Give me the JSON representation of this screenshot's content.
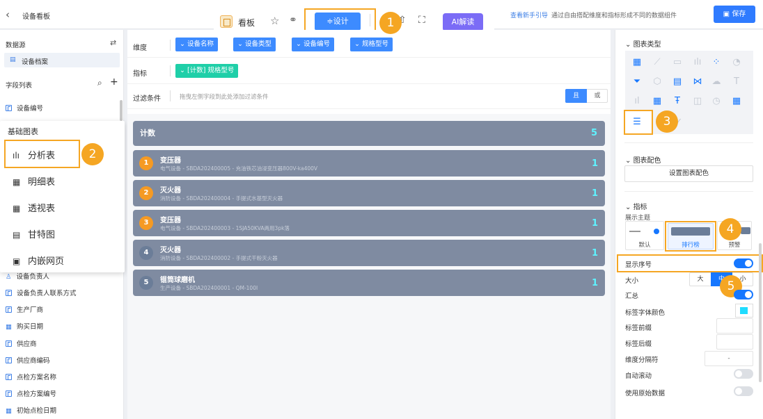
{
  "header": {
    "back_icon": "chevron-left-icon",
    "title": "设备看板",
    "board_label": "看板",
    "design_label": "≑设计",
    "ai_label": "AI解读",
    "guide_link": "查看新手引导",
    "guide_desc": "通过自由搭配维度和指标形成不同的数据组件",
    "save_label": "保存"
  },
  "badges": [
    "1",
    "2",
    "3",
    "4",
    "5"
  ],
  "left": {
    "datasource_title": "数据源",
    "datasource_item": "设备档案",
    "field_list_title": "字段列表",
    "fields_top": [
      "设备编号"
    ],
    "menu_title": "基础图表",
    "menu_items": [
      {
        "label": "分析表",
        "icon": "bar-chart-icon"
      },
      {
        "label": "明细表",
        "icon": "table-icon"
      },
      {
        "label": "透视表",
        "icon": "pivot-table-icon"
      },
      {
        "label": "甘特图",
        "icon": "gantt-icon"
      },
      {
        "label": "内嵌网页",
        "icon": "webpage-icon"
      }
    ],
    "fields": [
      "设备负责人",
      "设备负责人联系方式",
      "生产厂商",
      "购买日期",
      "供应商",
      "供应商编码",
      "点检方案名称",
      "点检方案编号",
      "初始点检日期"
    ]
  },
  "config": {
    "dimension_label": "维度",
    "dimensions": [
      "设备名称",
      "设备类型",
      "设备编号",
      "规格型号"
    ],
    "metric_label": "指标",
    "metrics": [
      "[计数] 规格型号"
    ],
    "filter_label": "过滤条件",
    "filter_hint": "拖曳左侧字段到此处添加过滤条件",
    "filter_and": "且",
    "filter_or": "或"
  },
  "chart_data": {
    "type": "table",
    "total_label": "计数",
    "total_value": 5,
    "rows": [
      {
        "rank": "1",
        "name": "变压器",
        "detail": "电气设备 - SBDA202400005 - 充油铁芯油浸变压器800V-ka400V",
        "value": 1
      },
      {
        "rank": "2",
        "name": "灭火器",
        "detail": "消防设备 - SBDA202400004 - 手提式水基型灭火器",
        "value": 1
      },
      {
        "rank": "3",
        "name": "变压器",
        "detail": "电气设备 - SBDA202400003 - 1SJA50KVA两用3pk落",
        "value": 1
      },
      {
        "rank": "4",
        "name": "灭火器",
        "detail": "消防设备 - SBDA202400002 - 手提式干粉灭火器",
        "value": 1
      },
      {
        "rank": "5",
        "name": "锟筒球磨机",
        "detail": "生产设备 - SBDA202400001 - QM-100I",
        "value": 1
      }
    ]
  },
  "right": {
    "chart_type_title": "图表类型",
    "chart_color_title": "图表配色",
    "set_color_label": "设置图表配色",
    "metric_section_title": "指标",
    "theme_label": "展示主题",
    "themes": [
      "默认",
      "排行榜",
      "预警"
    ],
    "props": {
      "show_index": "显示序号",
      "size": "大小",
      "size_options": [
        "大",
        "中",
        "小"
      ],
      "summary": "汇总",
      "label_font_color": "标签字体颜色",
      "label_prefix": "标签前缀",
      "label_suffix": "标签后缀",
      "dim_separator": "维度分隔符",
      "dim_separator_value": "-",
      "auto_scroll": "自动滚动",
      "use_raw": "使用原始数据"
    },
    "colors": {
      "accent": "#1677ff",
      "label_color": "#1fdcff",
      "highlight": "#f5a623"
    }
  }
}
